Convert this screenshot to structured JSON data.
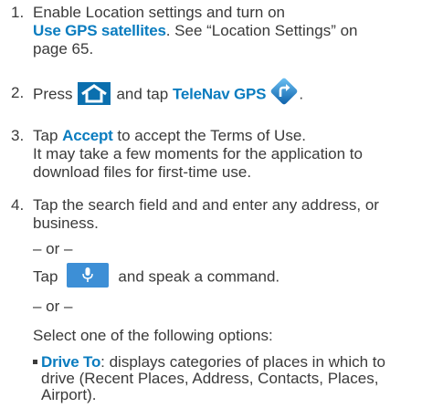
{
  "steps": [
    {
      "number": "1.",
      "line1": "Enable Location settings and turn on",
      "line2_bold": "Use GPS satellites",
      "line2_rest": ". See “Location Settings” on",
      "line3": "page 65."
    },
    {
      "number": "2.",
      "press": "Press",
      "and_tap": "and tap",
      "app_name": "TeleNav GPS",
      "end": "."
    },
    {
      "number": "3.",
      "tap": "Tap",
      "accept": "Accept",
      "line1_rest": "to accept the Terms of Use.",
      "line2": "It may take a few moments for the application to",
      "line3": "download files for first-time use."
    },
    {
      "number": "4.",
      "line1": "Tap the search field and and enter any address, or",
      "line2": "business.",
      "or1": "– or –",
      "tap_mic_pre": "Tap",
      "tap_mic_post": "and speak a command.",
      "or2": "– or –",
      "select": "Select one of the following options:",
      "bullet": {
        "title": "Drive To",
        "line1_rest": ": displays categories of places in which to",
        "line2": "drive (Recent Places, Address, Contacts, Places,",
        "line3": "Airport)."
      }
    }
  ],
  "icons": {
    "home": "home-icon",
    "navigation": "telenav-gps-icon",
    "microphone": "microphone-icon"
  },
  "colors": {
    "accent": "#0a7cbf",
    "mic_button": "#3d8fd6",
    "home_tile": "#0b6fae",
    "text": "#3a3a3a"
  }
}
